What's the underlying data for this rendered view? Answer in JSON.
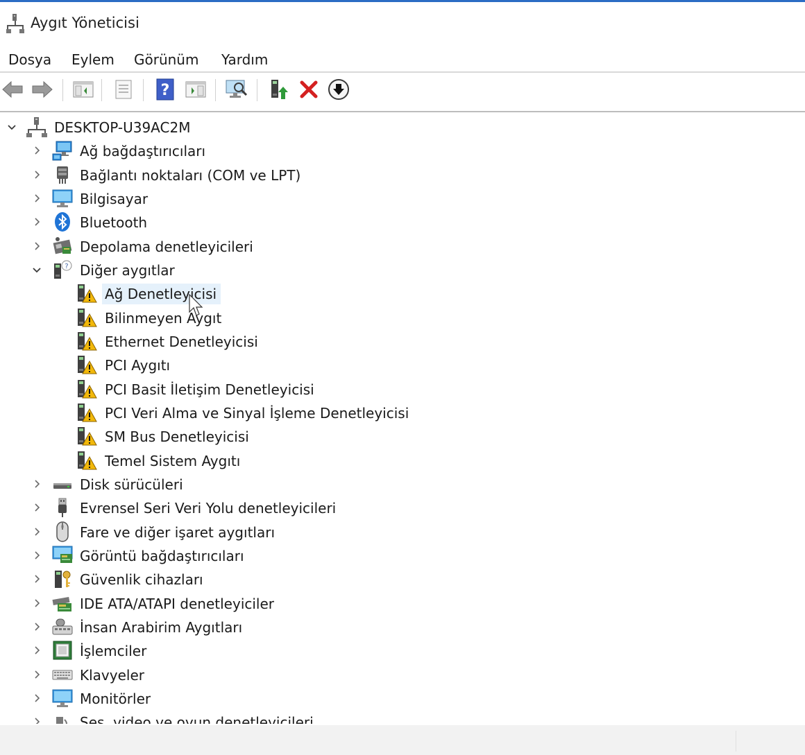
{
  "window": {
    "title": "Aygıt Yöneticisi"
  },
  "menu": [
    "Dosya",
    "Eylem",
    "Görünüm",
    "Yardım"
  ],
  "toolbar": [
    {
      "icon": "back-arrow-icon"
    },
    {
      "icon": "forward-arrow-icon"
    },
    {
      "icon": "show-hide-console-tree-icon"
    },
    {
      "icon": "properties-icon"
    },
    {
      "icon": "help-icon"
    },
    {
      "icon": "action-pane-icon"
    },
    {
      "icon": "scan-hardware-changes-icon"
    },
    {
      "icon": "update-driver-icon"
    },
    {
      "icon": "uninstall-device-icon"
    },
    {
      "icon": "disable-device-icon"
    }
  ],
  "tree": {
    "root": "DESKTOP-U39AC2M",
    "categories_before": [
      {
        "label": "Ağ bağdaştırıcıları",
        "icon": "network-adapter-icon"
      },
      {
        "label": "Bağlantı noktaları (COM ve LPT)",
        "icon": "port-icon"
      },
      {
        "label": "Bilgisayar",
        "icon": "computer-icon"
      },
      {
        "label": "Bluetooth",
        "icon": "bluetooth-icon"
      },
      {
        "label": "Depolama denetleyicileri",
        "icon": "storage-controller-icon"
      }
    ],
    "expanded": {
      "label": "Diğer aygıtlar",
      "icon": "other-devices-icon",
      "children": [
        "Ağ Denetleyicisi",
        "Bilinmeyen Aygıt",
        "Ethernet Denetleyicisi",
        "PCI Aygıtı",
        "PCI Basit İletişim Denetleyicisi",
        "PCI Veri Alma ve Sinyal İşleme Denetleyicisi",
        "SM Bus Denetleyicisi",
        "Temel Sistem Aygıtı"
      ],
      "selected_index": 0
    },
    "categories_after": [
      {
        "label": "Disk sürücüleri",
        "icon": "disk-drive-icon"
      },
      {
        "label": "Evrensel Seri Veri Yolu denetleyicileri",
        "icon": "usb-icon"
      },
      {
        "label": "Fare ve diğer işaret aygıtları",
        "icon": "mouse-icon"
      },
      {
        "label": "Görüntü bağdaştırıcıları",
        "icon": "display-adapter-icon"
      },
      {
        "label": "Güvenlik cihazları",
        "icon": "security-device-icon"
      },
      {
        "label": "IDE ATA/ATAPI denetleyiciler",
        "icon": "ide-controller-icon"
      },
      {
        "label": "İnsan Arabirim Aygıtları",
        "icon": "hid-icon"
      },
      {
        "label": "İşlemciler",
        "icon": "processor-icon"
      },
      {
        "label": "Klavyeler",
        "icon": "keyboard-icon"
      },
      {
        "label": "Monitörler",
        "icon": "monitor-icon"
      },
      {
        "label": "Ses, video ve oyun denetleyicileri",
        "icon": "sound-icon"
      }
    ]
  },
  "colors": {
    "accent": "#2b6cc4",
    "selection": "#e5f1fb",
    "warning": "#f2b80a",
    "error": "#d42020"
  }
}
